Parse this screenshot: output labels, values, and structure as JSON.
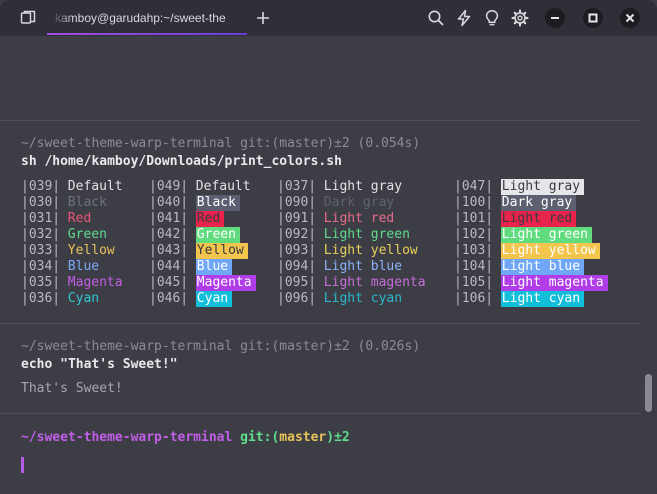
{
  "window": {
    "tab_title": "kamboy@garudahp:~/sweet-the",
    "colors": {
      "background": "#3d3e45",
      "titlebar": "#2f3037",
      "accent": "#a24ee0"
    },
    "icons": [
      "tabs-panel-icon",
      "plus-icon",
      "search-icon",
      "lightning-icon",
      "lightbulb-icon",
      "gear-icon",
      "minimize-icon",
      "maximize-icon",
      "close-icon"
    ]
  },
  "blocks": [
    {
      "meta": "~/sweet-theme-warp-terminal git:(master)±2 (0.054s)",
      "command": "sh /home/kamboy/Downloads/print_colors.sh"
    },
    {
      "meta": "~/sweet-theme-warp-terminal git:(master)±2 (0.026s)",
      "command": "echo \"That's Sweet!\"",
      "output": "That's Sweet!"
    }
  ],
  "color_table": [
    [
      "|039| ",
      "Default",
      "|049| ",
      "Default",
      "|037| ",
      "Light gray",
      "|047| ",
      "Light gray"
    ],
    [
      "|030| ",
      "Black",
      "|040| ",
      "Black",
      "|090| ",
      "Dark gray",
      "|100| ",
      "Dark gray"
    ],
    [
      "|031| ",
      "Red",
      "|041| ",
      "Red",
      "|091| ",
      "Light red",
      "|101| ",
      "Light red"
    ],
    [
      "|032| ",
      "Green",
      "|042| ",
      "Green",
      "|092| ",
      "Light green",
      "|102| ",
      "Light green"
    ],
    [
      "|033| ",
      "Yellow",
      "|043| ",
      "Yellow",
      "|093| ",
      "Light yellow",
      "|103| ",
      "Light yellow"
    ],
    [
      "|034| ",
      "Blue",
      "|044| ",
      "Blue",
      "|094| ",
      "Light blue",
      "|104| ",
      "Light blue"
    ],
    [
      "|035| ",
      "Magenta",
      "|045| ",
      "Magenta",
      "|095| ",
      "Light magenta",
      "|105| ",
      "Light magenta"
    ],
    [
      "|036| ",
      "Cyan",
      "|046| ",
      "Cyan",
      "|096| ",
      "Light cyan",
      "|106| ",
      "Light cyan"
    ]
  ],
  "palette": {
    "fg": [
      "#e2e2e6",
      "#6f7080",
      "#ea5478",
      "#5fdc8c",
      "#e8c25a",
      "#7aa8f8",
      "#c45ee8",
      "#2fc8d4"
    ],
    "bg": [
      null,
      "#5b5e70",
      "#e8244c",
      "#60dc7e",
      "#f3c54d",
      "#6fa6f5",
      "#b03de8",
      "#11bfd8"
    ],
    "light_fg": [
      "#e2e2e6",
      "#5f6070",
      "#e86b8a",
      "#5fdc8c",
      "#e6cf5c",
      "#8cb2f8",
      "#c56ed8",
      "#2bb8cc"
    ],
    "light_bg": [
      "#e6e6ea",
      "#5d6070",
      "#e8244c",
      "#60dc7e",
      "#f3c54d",
      "#6fa6f5",
      "#b03de8",
      "#11bfd8"
    ],
    "light_bg_text": [
      "#3a3b42",
      "#ffffff",
      "#3a3b42",
      "#ffffff",
      "#ffffff",
      "#ffffff",
      "#ffffff",
      "#ffffff"
    ],
    "bg_text": [
      null,
      "#ffffff",
      "#3a3b42",
      "#ffffff",
      "#3a3b42",
      "#ffffff",
      "#ffffff",
      "#ffffff"
    ]
  },
  "prompt": {
    "path": "~/sweet-theme-warp-terminal",
    "git_prefix": " git:(",
    "branch": "master",
    "git_suffix": ")±2",
    "colors": {
      "path": "#c05ee8",
      "git": "#5fdc8c",
      "branch": "#e8c25a"
    }
  }
}
